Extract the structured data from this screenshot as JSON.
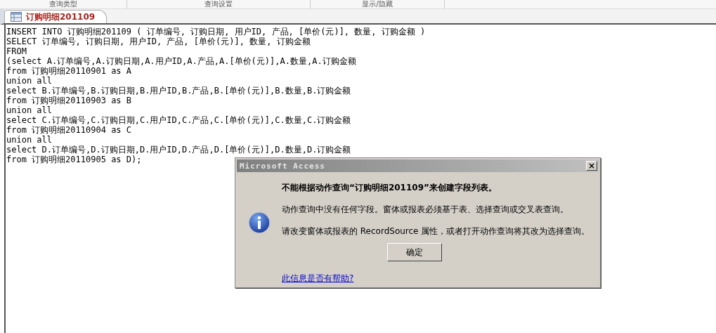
{
  "ribbon_groups": [
    "查询类型",
    "查询设置",
    "显示/隐藏"
  ],
  "tabs": [
    {
      "label": "订购明细201109",
      "selected": true
    }
  ],
  "sql_lines": [
    "INSERT INTO 订购明细201109 ( 订单编号, 订购日期, 用户ID, 产品, [单价(元)], 数量, 订购金额 )",
    "SELECT 订单编号, 订购日期, 用户ID, 产品, [单价(元)], 数量, 订购金额",
    "FROM",
    "(select A.订单编号,A.订购日期,A.用户ID,A.产品,A.[单价(元)],A.数量,A.订购金额",
    "from 订购明细20110901 as A",
    "union all",
    "select B.订单编号,B.订购日期,B.用户ID,B.产品,B.[单价(元)],B.数量,B.订购金额",
    "from 订购明细20110903 as B",
    "union all",
    "select C.订单编号,C.订购日期,C.用户ID,C.产品,C.[单价(元)],C.数量,C.订购金额",
    "from 订购明细20110904 as C",
    "union all",
    "select D.订单编号,D.订购日期,D.用户ID,D.产品,D.[单价(元)],D.数量,D.订购金额",
    "from 订购明细20110905 as D);"
  ],
  "dialog": {
    "title": "Microsoft Access",
    "close": "×",
    "heading": "不能根据动作查询“订购明细201109”来创建字段列表。",
    "messages": [
      "动作查询中没有任何字段。窗体或报表必须基于表、选择查询或交叉表查询。",
      "请改变窗体或报表的 RecordSource 属性，或者打开动作查询将其改为选择查询。"
    ],
    "button": "确定",
    "help_link": "此信息是否有帮助?"
  }
}
